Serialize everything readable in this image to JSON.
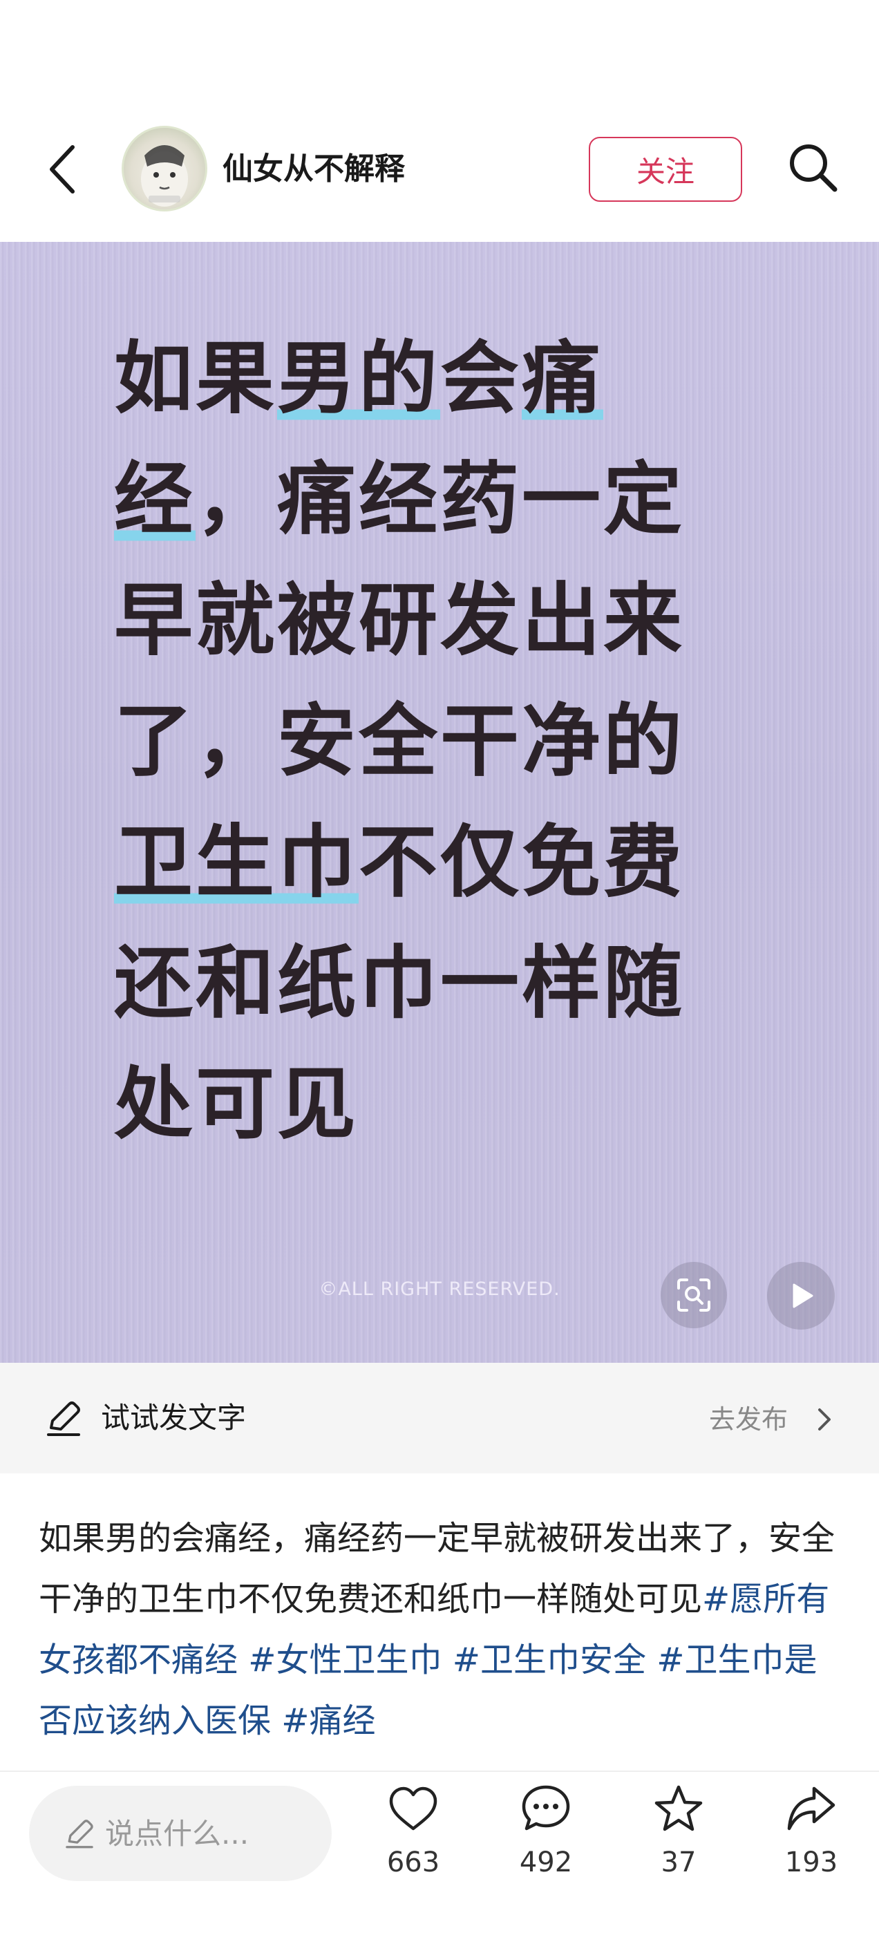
{
  "header": {
    "username": "仙女从不解释",
    "follow_label": "关注"
  },
  "post": {
    "text_segments": [
      {
        "text": "如果",
        "hl": false
      },
      {
        "text": "男的",
        "hl": true
      },
      {
        "text": "会",
        "hl": false
      },
      {
        "text": "痛经",
        "hl": true
      },
      {
        "text": "，痛经药一定早就被研发出来了，安全干净的",
        "hl": false
      },
      {
        "text": "卫生巾",
        "hl": true
      },
      {
        "text": "不仅免费还和纸巾一样随处可见",
        "hl": false
      }
    ],
    "watermark": "©ALL RIGHT RESERVED."
  },
  "compose": {
    "label": "试试发文字",
    "publish_label": "去发布"
  },
  "description": {
    "text": "如果男的会痛经，痛经药一定早就被研发出来了，安全干净的卫生巾不仅免费还和纸巾一样随处可见",
    "hashtags": [
      "#愿所有女孩都不痛经",
      "#女性卫生巾",
      "#卫生巾安全",
      "#卫生巾是否应该纳入医保",
      "#痛经"
    ]
  },
  "bottom_bar": {
    "comment_placeholder": "说点什么...",
    "likes": "663",
    "comments": "492",
    "favorites": "37",
    "shares": "193"
  },
  "colors": {
    "accent": "#d6375a",
    "hashtag": "#1f4e8c",
    "post_background": "#c5bfe0",
    "highlight": "#86d4ec"
  }
}
